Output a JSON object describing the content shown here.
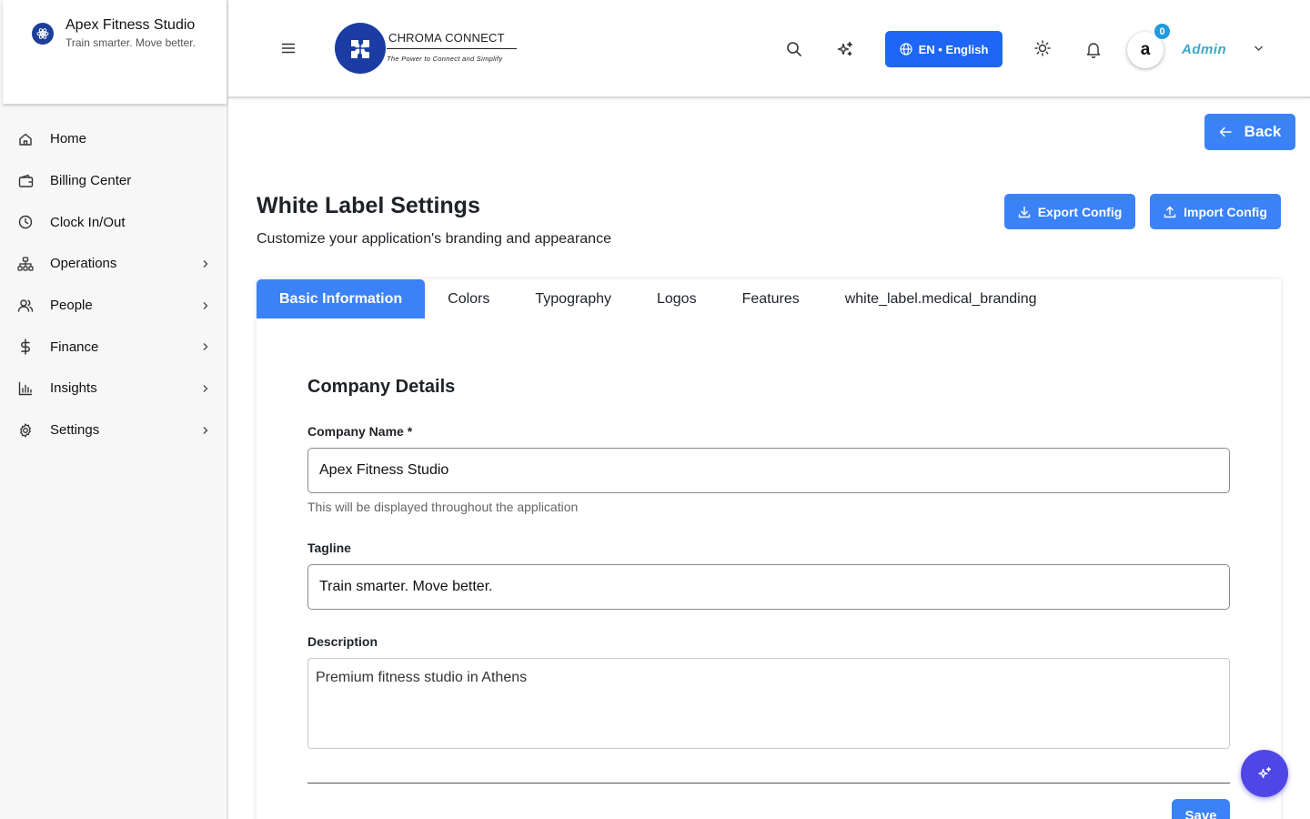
{
  "brand": {
    "name": "Apex Fitness Studio",
    "tagline": "Train smarter. Move better.",
    "logo_icon": "atom-icon"
  },
  "sidebar": {
    "items": [
      {
        "label": "Home",
        "icon": "home-icon",
        "expandable": false
      },
      {
        "label": "Billing Center",
        "icon": "wallet-icon",
        "expandable": false
      },
      {
        "label": "Clock In/Out",
        "icon": "clock-icon",
        "expandable": false
      },
      {
        "label": "Operations",
        "icon": "sitemap-icon",
        "expandable": true
      },
      {
        "label": "People",
        "icon": "users-icon",
        "expandable": true
      },
      {
        "label": "Finance",
        "icon": "dollar-icon",
        "expandable": true
      },
      {
        "label": "Insights",
        "icon": "bar-chart-icon",
        "expandable": true
      },
      {
        "label": "Settings",
        "icon": "gear-icon",
        "expandable": true
      }
    ]
  },
  "header": {
    "logo_title": "CHROMA CONNECT",
    "logo_subtitle": "The Power to Connect and Simplify",
    "language_label": "EN • English",
    "notification_count": "0",
    "avatar_initial": "a",
    "user_name": "Admin"
  },
  "main": {
    "back_label": "Back",
    "title": "White Label Settings",
    "subtitle": "Customize your application's branding and appearance",
    "export_label": "Export Config",
    "import_label": "Import Config",
    "tabs": [
      {
        "label": "Basic Information",
        "active": true
      },
      {
        "label": "Colors",
        "active": false
      },
      {
        "label": "Typography",
        "active": false
      },
      {
        "label": "Logos",
        "active": false
      },
      {
        "label": "Features",
        "active": false
      },
      {
        "label": "white_label.medical_branding",
        "active": false
      }
    ],
    "section_title": "Company Details",
    "company_name_label": "Company Name *",
    "company_name_value": "Apex Fitness Studio",
    "company_name_helper": "This will be displayed throughout the application",
    "tagline_label": "Tagline",
    "tagline_value": "Train smarter. Move better.",
    "description_label": "Description",
    "description_value": "Premium fitness studio in Athens",
    "save_label": "Save"
  },
  "colors": {
    "primary": "#3b82f6",
    "language_button": "#1e66f5",
    "badge": "#1f9ae0",
    "admin_text": "#3aa9c9",
    "fab": "#4f46e5",
    "brand_blue": "#1a3ca3"
  }
}
